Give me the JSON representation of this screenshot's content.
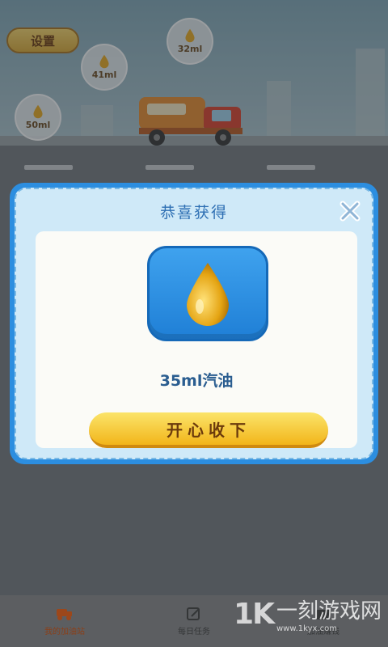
{
  "top_bar": {
    "settings_label": "设置"
  },
  "bubbles": [
    {
      "label": "32ml",
      "icon": "oil-drop-icon"
    },
    {
      "label": "41ml",
      "icon": "oil-drop-icon"
    },
    {
      "label": "50ml",
      "icon": "oil-drop-icon"
    }
  ],
  "dialog": {
    "title": "恭喜获得",
    "close_icon": "close-icon",
    "reward_icon": "oil-drop-icon",
    "reward_text": "35ml汽油",
    "accept_label": "开心收下"
  },
  "bottom_nav": {
    "items": [
      {
        "label": "我的加油站",
        "icon": "truck-icon",
        "active": true
      },
      {
        "label": "每日任务",
        "icon": "edit-icon",
        "active": false
      },
      {
        "label": "加油赚钱",
        "icon": "wallet-icon",
        "active": false
      }
    ]
  },
  "watermark": {
    "logo": "1K",
    "title": "一刻游戏网",
    "url": "www.1kyx.com"
  },
  "colors": {
    "dialog_frame": "#2c8ee0",
    "accept_button": "#f2b51a",
    "reward_tile": "#1f7fd6",
    "active_nav": "#a34a1c"
  }
}
